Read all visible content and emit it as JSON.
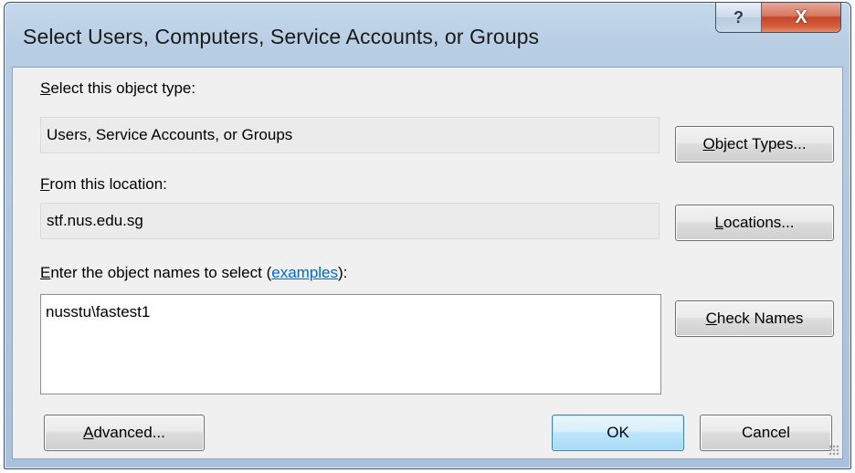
{
  "window": {
    "title": "Select Users, Computers, Service Accounts, or Groups",
    "help_glyph": "?",
    "close_glyph": "X"
  },
  "object_type": {
    "label_key": "S",
    "label_rest": "elect this object type:",
    "value": "Users, Service Accounts, or Groups",
    "button_key": "O",
    "button_rest": "bject Types..."
  },
  "location": {
    "label_key": "F",
    "label_rest": "rom this location:",
    "value": "stf.nus.edu.sg",
    "button_key": "L",
    "button_rest": "ocations..."
  },
  "names": {
    "label_key": "E",
    "label_rest": "nter the object names to select (",
    "label_link": "examples",
    "label_end": "):",
    "value": "nusstu\\fastest1",
    "check_key": "C",
    "check_rest": "heck Names"
  },
  "footer": {
    "advanced_key": "A",
    "advanced_rest": "dvanced...",
    "ok_label": "OK",
    "cancel_label": "Cancel"
  }
}
